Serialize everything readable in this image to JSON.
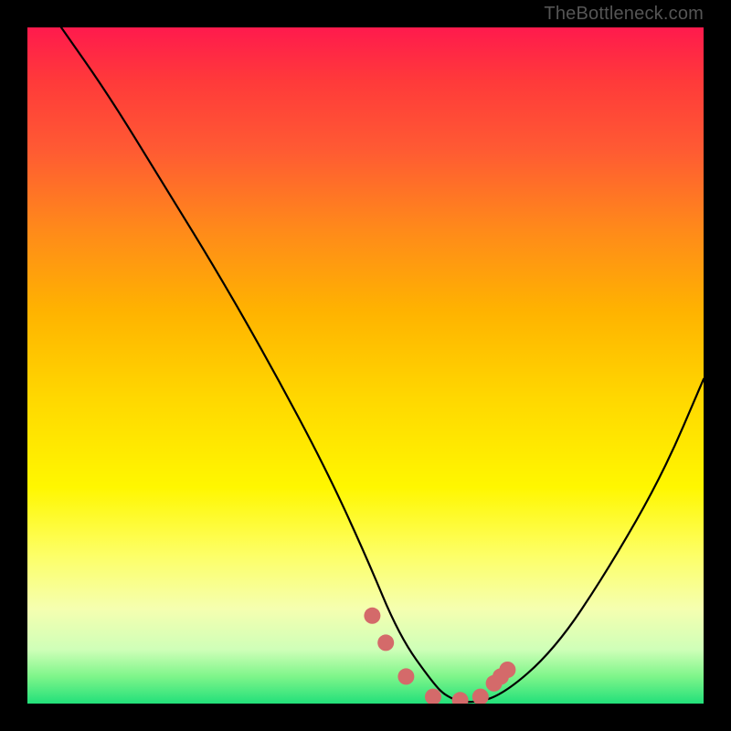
{
  "attribution": "TheBottleneck.com",
  "chart_data": {
    "type": "line",
    "title": "",
    "xlabel": "",
    "ylabel": "",
    "xlim": [
      0,
      100
    ],
    "ylim": [
      0,
      100
    ],
    "series": [
      {
        "name": "bottleneck-curve",
        "x": [
          5,
          12,
          20,
          28,
          36,
          44,
          50,
          55,
          60,
          62,
          65,
          70,
          78,
          86,
          94,
          100
        ],
        "values": [
          100,
          90,
          77,
          64,
          50,
          35,
          22,
          10,
          3,
          1,
          0,
          1,
          8,
          20,
          34,
          48
        ]
      }
    ],
    "markers": {
      "name": "highlight-points",
      "color": "#d46a6a",
      "x": [
        51,
        53,
        56,
        60,
        64,
        67,
        69,
        70,
        71
      ],
      "values": [
        13,
        9,
        4,
        1,
        0.5,
        1,
        3,
        4,
        5
      ]
    },
    "background": "vertical-gradient red→orange→yellow→green"
  }
}
